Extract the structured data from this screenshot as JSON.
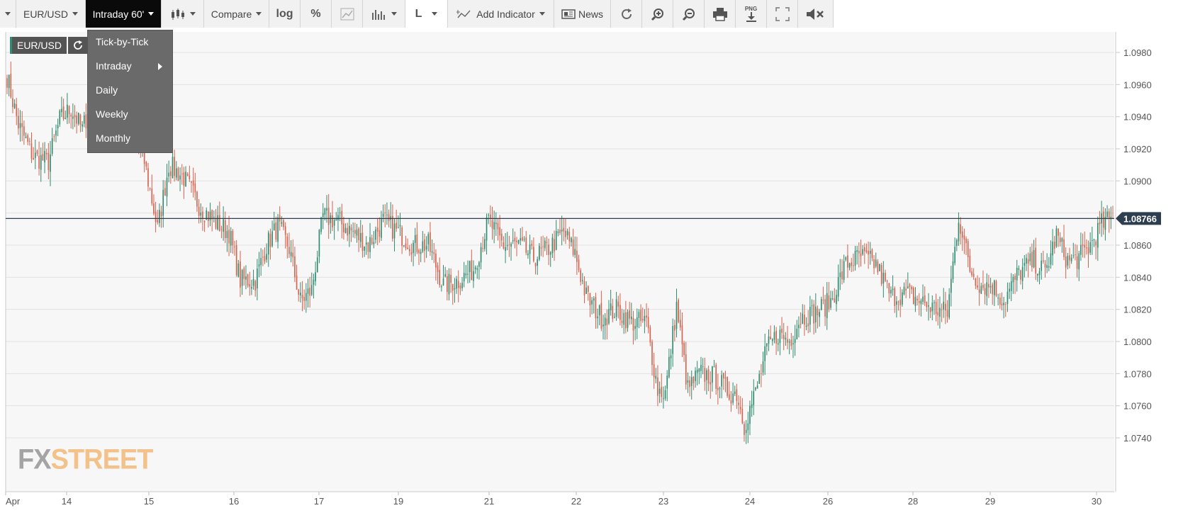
{
  "toolbar": {
    "symbol": "EUR/USD",
    "interval": "Intraday 60'",
    "compare": "Compare",
    "log": "log",
    "percent": "%",
    "style": "L",
    "add_indicator": "Add Indicator",
    "news": "News",
    "png": "PNG"
  },
  "interval_menu": {
    "items": [
      "Tick-by-Tick",
      "Intraday",
      "Daily",
      "Weekly",
      "Monthly"
    ]
  },
  "chart_overlay": {
    "symbol_label": "EUR/USD",
    "logo_fx": "FX",
    "logo_street": "STREET"
  },
  "chart_data": {
    "type": "candlestick",
    "symbol": "EUR/USD",
    "interval": "60'",
    "x_ticks": [
      "Apr",
      "14",
      "15",
      "16",
      "17",
      "19",
      "21",
      "22",
      "23",
      "24",
      "26",
      "28",
      "29",
      "30"
    ],
    "y_ticks": [
      "1.0980",
      "1.0960",
      "1.0940",
      "1.0920",
      "1.0900",
      "1.0860",
      "1.0840",
      "1.0820",
      "1.0800",
      "1.0780",
      "1.0760",
      "1.0740"
    ],
    "ylim": [
      1.0727,
      1.0997
    ],
    "current_price": "1.08766",
    "current_price_value": 1.08766,
    "grid": true,
    "colors": {
      "up": "#2e8b6e",
      "down": "#d9604c",
      "price_line": "#2c3e50"
    },
    "waypoints": [
      [
        0,
        1.0965
      ],
      [
        6,
        1.0935
      ],
      [
        14,
        1.0915
      ],
      [
        22,
        1.0912
      ],
      [
        28,
        1.0938
      ],
      [
        34,
        1.0945
      ],
      [
        40,
        1.0932
      ],
      [
        48,
        1.096
      ],
      [
        58,
        1.0975
      ],
      [
        64,
        1.0935
      ],
      [
        72,
        1.0918
      ],
      [
        80,
        1.087
      ],
      [
        86,
        1.091
      ],
      [
        94,
        1.0902
      ],
      [
        102,
        1.0885
      ],
      [
        110,
        1.0875
      ],
      [
        118,
        1.0868
      ],
      [
        124,
        1.0838
      ],
      [
        132,
        1.0838
      ],
      [
        138,
        1.086
      ],
      [
        144,
        1.0872
      ],
      [
        150,
        1.0858
      ],
      [
        156,
        1.0825
      ],
      [
        162,
        1.0832
      ],
      [
        168,
        1.0878
      ],
      [
        176,
        1.0875
      ],
      [
        184,
        1.0868
      ],
      [
        192,
        1.086
      ],
      [
        200,
        1.0875
      ],
      [
        208,
        1.0868
      ],
      [
        216,
        1.086
      ],
      [
        224,
        1.086
      ],
      [
        232,
        1.0835
      ],
      [
        240,
        1.0838
      ],
      [
        248,
        1.0845
      ],
      [
        256,
        1.0875
      ],
      [
        264,
        1.086
      ],
      [
        272,
        1.086
      ],
      [
        280,
        1.0852
      ],
      [
        288,
        1.0858
      ],
      [
        296,
        1.0868
      ],
      [
        302,
        1.0855
      ],
      [
        308,
        1.0828
      ],
      [
        316,
        1.0815
      ],
      [
        324,
        1.082
      ],
      [
        332,
        1.0812
      ],
      [
        340,
        1.0812
      ],
      [
        346,
        1.077
      ],
      [
        350,
        1.0768
      ],
      [
        356,
        1.0822
      ],
      [
        362,
        1.077
      ],
      [
        368,
        1.078
      ],
      [
        376,
        1.0778
      ],
      [
        384,
        1.0768
      ],
      [
        388,
        1.0768
      ],
      [
        392,
        1.0748
      ],
      [
        398,
        1.0768
      ],
      [
        404,
        1.0795
      ],
      [
        410,
        1.0805
      ],
      [
        416,
        1.08
      ],
      [
        422,
        1.0815
      ],
      [
        430,
        1.0818
      ],
      [
        438,
        1.0825
      ],
      [
        446,
        1.0848
      ],
      [
        454,
        1.0853
      ],
      [
        462,
        1.0848
      ],
      [
        470,
        1.0828
      ],
      [
        478,
        1.083
      ],
      [
        486,
        1.0825
      ],
      [
        494,
        1.082
      ],
      [
        500,
        1.0818
      ],
      [
        506,
        1.0878
      ],
      [
        512,
        1.0845
      ],
      [
        518,
        1.0835
      ],
      [
        524,
        1.0835
      ],
      [
        530,
        1.0825
      ],
      [
        538,
        1.0843
      ],
      [
        546,
        1.085
      ],
      [
        552,
        1.0843
      ],
      [
        558,
        1.0866
      ],
      [
        564,
        1.085
      ],
      [
        570,
        1.0852
      ],
      [
        576,
        1.086
      ],
      [
        582,
        1.0873
      ],
      [
        588,
        1.08766
      ]
    ]
  }
}
